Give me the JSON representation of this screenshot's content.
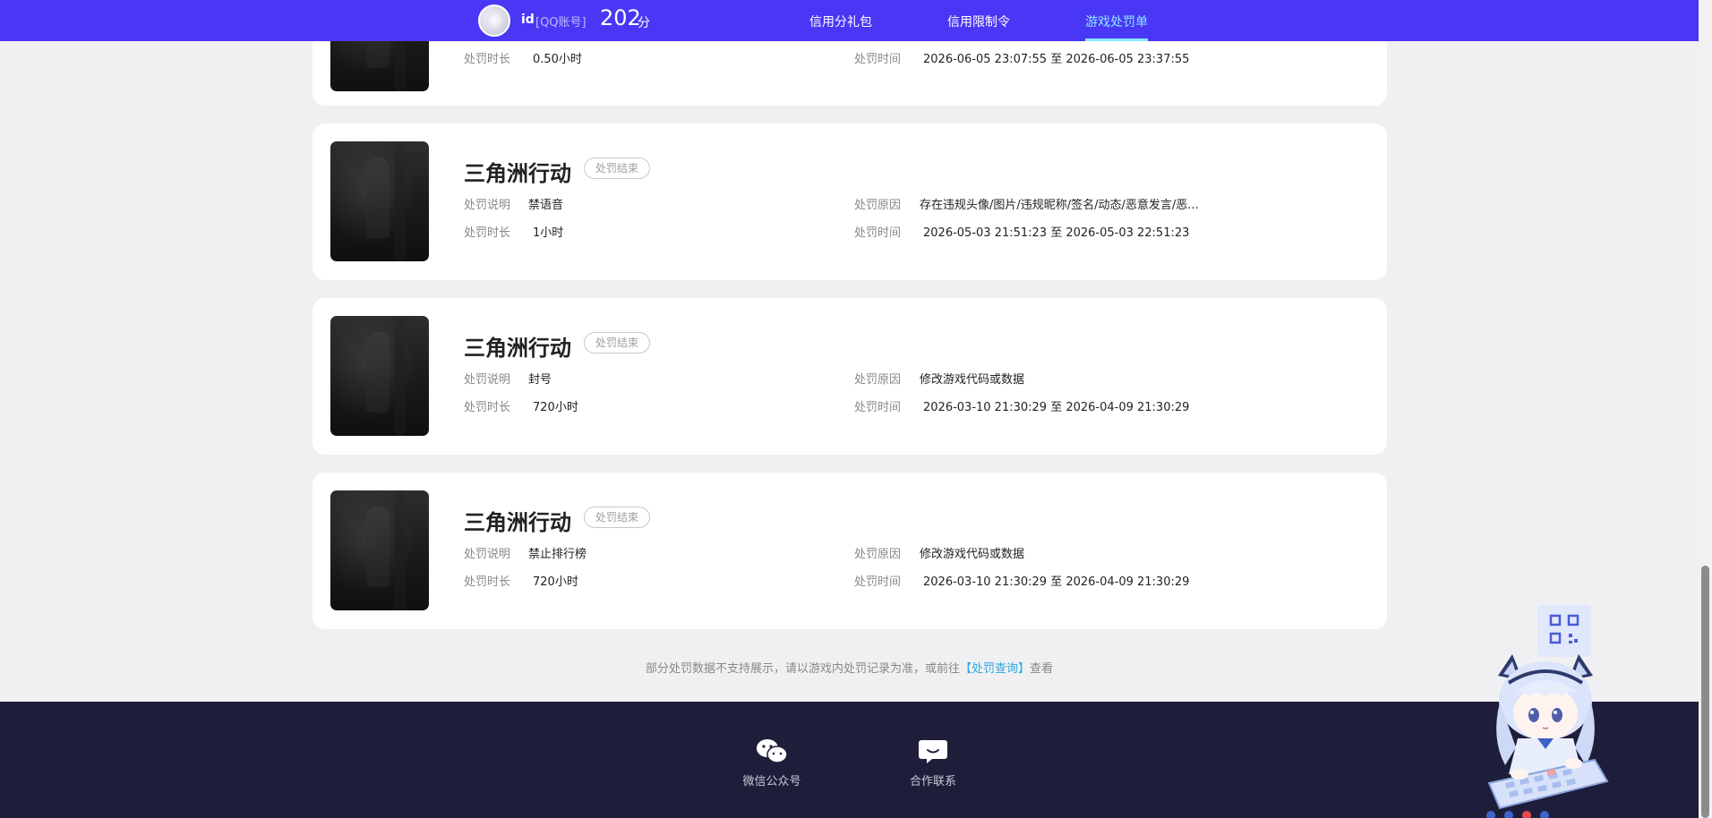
{
  "header": {
    "user_id": "id",
    "account_type": "[QQ账号]",
    "score": "202",
    "score_unit": "分",
    "tabs": [
      {
        "label": "信用分礼包",
        "active": false
      },
      {
        "label": "信用限制令",
        "active": false
      },
      {
        "label": "游戏处罚单",
        "active": true
      }
    ]
  },
  "labels": {
    "desc": "处罚说明",
    "duration": "处罚时长",
    "reason": "处罚原因",
    "time": "处罚时间"
  },
  "records": [
    {
      "duration": "0.50小时",
      "time": "2026-06-05 23:07:55 至 2026-06-05 23:37:55"
    },
    {
      "game": "三角洲行动",
      "status": "处罚结束",
      "desc": "禁语音",
      "reason": "存在违规头像/图片/违规昵称/签名/动态/恶意发言/恶...",
      "duration": "1小时",
      "time": "2026-05-03 21:51:23 至 2026-05-03 22:51:23"
    },
    {
      "game": "三角洲行动",
      "status": "处罚结束",
      "desc": "封号",
      "reason": "修改游戏代码或数据",
      "duration": "720小时",
      "time": "2026-03-10 21:30:29 至 2026-04-09 21:30:29"
    },
    {
      "game": "三角洲行动",
      "status": "处罚结束",
      "desc": "禁止排行榜",
      "reason": "修改游戏代码或数据",
      "duration": "720小时",
      "time": "2026-03-10 21:30:29 至 2026-04-09 21:30:29"
    }
  ],
  "note": {
    "text_before": "部分处罚数据不支持展示，请以游戏内处罚记录为准，或前往",
    "link": "【处罚查询】",
    "text_after": "查看"
  },
  "footer": {
    "wechat_label": "微信公众号",
    "contact_label": "合作联系"
  },
  "colors": {
    "nav_bg": "#4a36f5",
    "active_tab": "#8ae9ff",
    "footer_bg": "#1e1e3a",
    "link": "#2aa8e0"
  }
}
